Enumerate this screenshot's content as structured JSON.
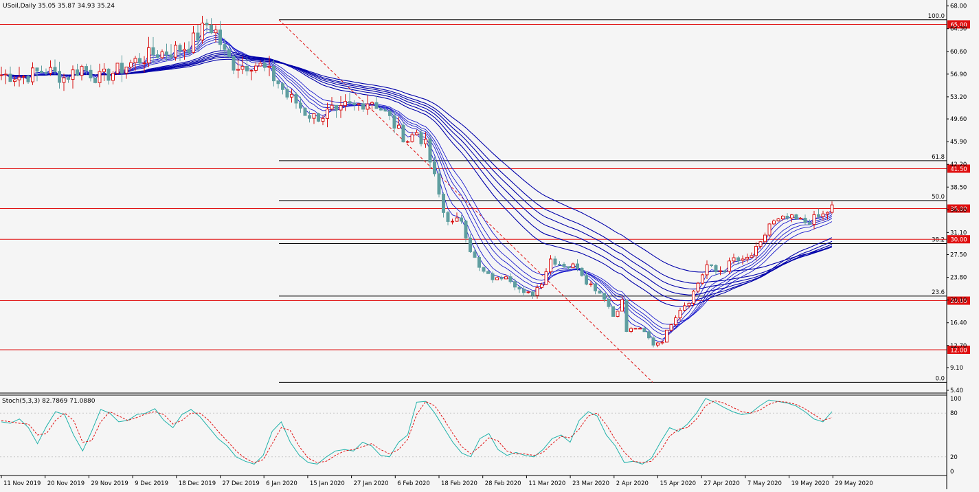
{
  "main_header": "USoil,Daily  35.05 35.87 34.93 35.24",
  "stoch_header": "Stoch(5,3,3) 82.7869 71.0880",
  "chart_data": [
    {
      "type": "candlestick",
      "symbol": "USoil",
      "timeframe": "Daily",
      "ohlc_last": {
        "open": 35.05,
        "high": 35.87,
        "low": 34.93,
        "close": 35.24
      },
      "x_labels": [
        "11 Nov 2019",
        "20 Nov 2019",
        "29 Nov 2019",
        "9 Dec 2019",
        "18 Dec 2019",
        "27 Dec 2019",
        "6 Jan 2020",
        "15 Jan 2020",
        "27 Jan 2020",
        "6 Feb 2020",
        "18 Feb 2020",
        "28 Feb 2020",
        "11 Mar 2020",
        "23 Mar 2020",
        "2 Apr 2020",
        "15 Apr 2020",
        "27 Apr 2020",
        "7 May 2020",
        "19 May 2020",
        "29 May 2020"
      ],
      "y_ticks": [
        68.0,
        64.3,
        60.6,
        56.9,
        53.2,
        49.6,
        45.9,
        42.2,
        38.5,
        34.8,
        31.1,
        27.5,
        23.8,
        20.1,
        16.4,
        12.7,
        9.1,
        5.4
      ],
      "ylim": [
        4.4,
        68.8
      ],
      "close_path": [
        [
          0,
          56.8
        ],
        [
          5,
          56.5
        ],
        [
          10,
          57.6
        ],
        [
          14,
          56.3
        ],
        [
          18,
          58.0
        ],
        [
          22,
          56.2
        ],
        [
          26,
          57.5
        ],
        [
          30,
          59.0
        ],
        [
          34,
          60.2
        ],
        [
          38,
          60.6
        ],
        [
          42,
          61.6
        ],
        [
          44,
          63.2
        ],
        [
          46,
          65.0
        ],
        [
          48,
          63.8
        ],
        [
          50,
          60.2
        ],
        [
          52,
          58.5
        ],
        [
          54,
          58.3
        ],
        [
          56,
          58.7
        ],
        [
          58,
          58.2
        ],
        [
          60,
          57.0
        ],
        [
          62,
          55.5
        ],
        [
          64,
          53.3
        ],
        [
          66,
          52.3
        ],
        [
          68,
          50.7
        ],
        [
          70,
          49.9
        ],
        [
          72,
          50.2
        ],
        [
          74,
          51.0
        ],
        [
          75,
          50.0
        ],
        [
          77,
          51.6
        ],
        [
          79,
          51.6
        ],
        [
          81,
          52.3
        ],
        [
          83,
          52.6
        ],
        [
          85,
          51.3
        ],
        [
          87,
          49.6
        ],
        [
          89,
          47.6
        ],
        [
          91,
          46.2
        ],
        [
          93,
          47.5
        ],
        [
          95,
          45.3
        ],
        [
          97,
          40.0
        ],
        [
          99,
          34.4
        ],
        [
          101,
          32.5
        ],
        [
          103,
          33.3
        ],
        [
          105,
          28.4
        ],
        [
          107,
          25.2
        ],
        [
          109,
          24.0
        ],
        [
          111,
          23.4
        ],
        [
          113,
          24.4
        ],
        [
          115,
          22.7
        ],
        [
          117,
          21.0
        ],
        [
          119,
          21.2
        ],
        [
          121,
          23.1
        ],
        [
          123,
          26.8
        ],
        [
          125,
          26.1
        ],
        [
          127,
          25.6
        ],
        [
          129,
          25.7
        ],
        [
          131,
          23.2
        ],
        [
          133,
          22.0
        ],
        [
          135,
          20.6
        ],
        [
          137,
          17.5
        ],
        [
          139,
          19.9
        ],
        [
          140,
          15.0
        ],
        [
          142,
          15.6
        ],
        [
          144,
          14.8
        ],
        [
          146,
          12.9
        ],
        [
          148,
          13.5
        ],
        [
          150,
          16.4
        ],
        [
          152,
          18.7
        ],
        [
          154,
          20.0
        ],
        [
          156,
          22.9
        ],
        [
          158,
          25.8
        ],
        [
          160,
          24.7
        ],
        [
          162,
          25.2
        ],
        [
          164,
          26.8
        ],
        [
          166,
          26.3
        ],
        [
          168,
          27.4
        ],
        [
          170,
          29.1
        ],
        [
          172,
          32.5
        ],
        [
          174,
          32.9
        ],
        [
          176,
          33.4
        ],
        [
          178,
          33.1
        ],
        [
          180,
          32.8
        ],
        [
          182,
          33.3
        ],
        [
          184,
          33.9
        ],
        [
          186,
          35.2
        ]
      ],
      "fibonacci": [
        {
          "label": "100.0",
          "value": 65.75
        },
        {
          "label": "61.8",
          "value": 42.8
        },
        {
          "label": "50.0",
          "value": 36.3
        },
        {
          "label": "38.2",
          "value": 29.3
        },
        {
          "label": "23.6",
          "value": 20.75
        },
        {
          "label": "0.0",
          "value": 6.7
        }
      ],
      "horizontal_levels": [
        {
          "label": "65.00",
          "value": 65.0
        },
        {
          "label": "41.50",
          "value": 41.5
        },
        {
          "label": "35.00",
          "value": 35.0
        },
        {
          "label": "30.00",
          "value": 30.0
        },
        {
          "label": "20.00",
          "value": 20.0
        },
        {
          "label": "12.00",
          "value": 12.0
        }
      ],
      "colors": {
        "background": "#f5f5f5",
        "bull": "#d81414",
        "bear": "#5f9ea0",
        "ema": "#0000aa",
        "level": "#e01010",
        "fib": "#000000",
        "stoch_main": "#20b2aa",
        "stoch_signal": "#e01010"
      }
    },
    {
      "type": "line",
      "name": "Stoch(5,3,3)",
      "y_ticks": [
        100,
        80,
        20,
        0
      ],
      "ylim": [
        0,
        100
      ],
      "main": [
        68,
        66,
        72,
        60,
        38,
        62,
        82,
        78,
        50,
        28,
        55,
        85,
        80,
        68,
        70,
        78,
        80,
        86,
        70,
        60,
        78,
        85,
        75,
        60,
        45,
        35,
        20,
        14,
        10,
        22,
        55,
        68,
        40,
        22,
        12,
        10,
        20,
        28,
        30,
        28,
        40,
        35,
        22,
        20,
        40,
        50,
        95,
        96,
        80,
        60,
        40,
        25,
        20,
        45,
        52,
        30,
        22,
        26,
        22,
        20,
        30,
        45,
        50,
        40,
        70,
        82,
        76,
        50,
        35,
        12,
        14,
        10,
        18,
        40,
        60,
        55,
        65,
        80,
        100,
        95,
        88,
        82,
        78,
        80,
        90,
        98,
        96,
        94,
        90,
        82,
        72,
        68,
        82
      ],
      "signal": [
        70,
        68,
        66,
        65,
        50,
        52,
        70,
        80,
        70,
        40,
        42,
        68,
        82,
        76,
        70,
        74,
        79,
        82,
        78,
        65,
        70,
        80,
        80,
        70,
        55,
        42,
        28,
        18,
        12,
        16,
        38,
        60,
        56,
        34,
        18,
        12,
        14,
        22,
        28,
        30,
        34,
        38,
        30,
        24,
        30,
        44,
        78,
        96,
        90,
        72,
        52,
        34,
        24,
        34,
        46,
        42,
        28,
        24,
        24,
        22,
        26,
        38,
        48,
        46,
        58,
        76,
        80,
        64,
        44,
        26,
        14,
        12,
        14,
        28,
        48,
        58,
        60,
        72,
        90,
        97,
        94,
        88,
        82,
        80,
        84,
        92,
        96,
        95,
        92,
        86,
        78,
        70,
        74
      ]
    }
  ]
}
